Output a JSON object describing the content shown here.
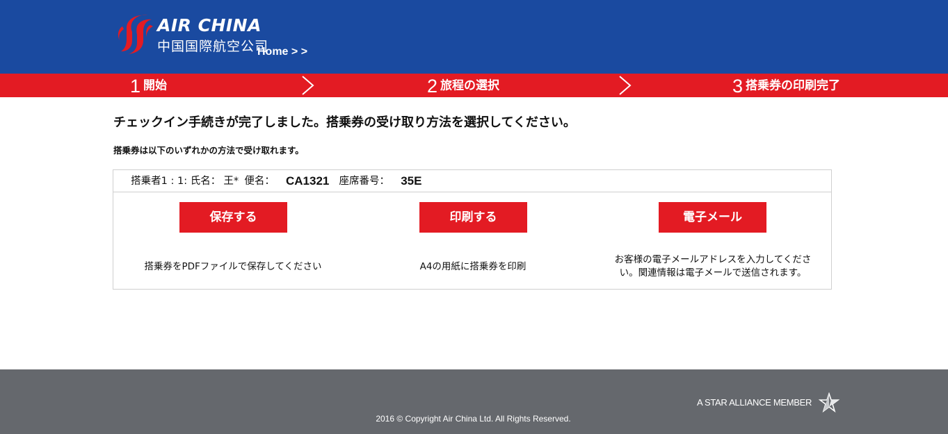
{
  "colors": {
    "brand_blue": "#1a4aa0",
    "brand_red": "#e31b23",
    "footer_gray": "#65686d"
  },
  "header": {
    "logo": {
      "icon": "air-china-phoenix-icon",
      "name_en": "AIR CHINA",
      "name_cn": "中国国際航空公司"
    },
    "breadcrumb": "Home > >"
  },
  "steps": [
    {
      "number": "1",
      "label": "開始"
    },
    {
      "number": "2",
      "label": "旅程の選択"
    },
    {
      "number": "3",
      "label": "搭乗券の印刷完了"
    }
  ],
  "main": {
    "title": "チェックイン手続きが完了しました。搭乗券の受け取り方法を選択してください。",
    "subtitle": "搭乗券は以下のいずれかの方法で受け取れます。",
    "passenger": {
      "prefix": "搭乗者1 : 1: 氏名：",
      "name": "王*",
      "flight_label": "便名：",
      "flight": "CA1321",
      "seat_label": "座席番号：",
      "seat": "35E"
    },
    "actions": [
      {
        "label": "保存する",
        "description": "搭乗券をPDFファイルで保存してください"
      },
      {
        "label": "印刷する",
        "description": "A4の用紙に搭乗券を印刷"
      },
      {
        "label": "電子メール",
        "description": "お客様の電子メールアドレスを入力してください。関連情報は電子メールで送信されます。"
      }
    ]
  },
  "footer": {
    "alliance": "A STAR ALLIANCE MEMBER",
    "alliance_icon": "star-alliance-icon",
    "copyright": "2016 © Copyright Air China Ltd. All Rights Reserved."
  }
}
